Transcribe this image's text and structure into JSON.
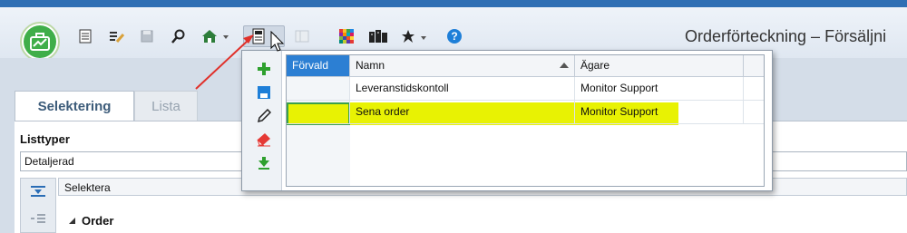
{
  "window": {
    "title": "Orderförteckning – Försäljni"
  },
  "toolbar": {
    "icons": [
      "list-icon",
      "edit-list-icon",
      "save-icon",
      "search-icon",
      "home-icon",
      "layout-icon",
      "dropdown-arrow-icon",
      "disabled-panel-icon",
      "color-grid-icon",
      "books-icon",
      "star-icon",
      "help-icon"
    ]
  },
  "tabs": [
    {
      "label": "Selektering",
      "active": true
    },
    {
      "label": "Lista",
      "active": false
    }
  ],
  "listtyper": {
    "label": "Listtyper",
    "value": "Detaljerad"
  },
  "grid": {
    "header": "Selektera",
    "group_label": "Order"
  },
  "popup": {
    "actions": [
      "add-icon",
      "save-icon",
      "edit-icon",
      "delete-icon",
      "download-icon"
    ],
    "columns": {
      "forvald": "Förvald",
      "namn": "Namn",
      "agare": "Ägare"
    },
    "rows": [
      {
        "forvald": "",
        "namn": "Leveranstidskontoll",
        "agare": "Monitor Support"
      },
      {
        "forvald": "",
        "namn": "Sena order",
        "agare": "Monitor Support"
      }
    ]
  },
  "colors": {
    "highlight": "#e8f203",
    "header_selected": "#2c7fd3",
    "accent_green": "#3fae49",
    "arrow_red": "#e0302a"
  }
}
